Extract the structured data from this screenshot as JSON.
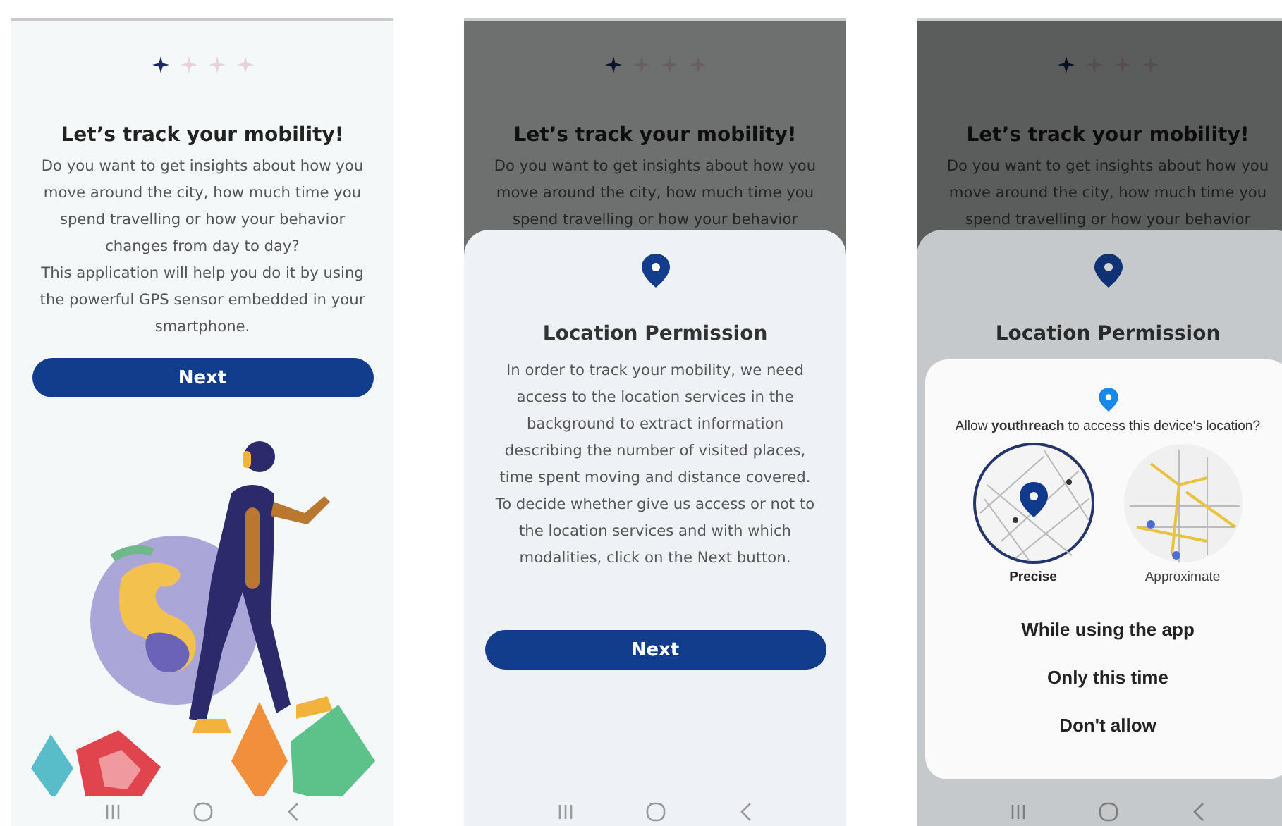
{
  "screens": [
    {
      "kind": "intro",
      "content": {
        "pager": [
          {
            "selected": true
          },
          {
            "selected": false
          },
          {
            "selected": false
          },
          {
            "selected": false
          }
        ],
        "title": "Let’s track your mobility!",
        "body": "Do you want to get insights about how you\nmove around the city, how much time you\nspend travelling or how your behavior\nchanges from day to day?\nThis application will help you do it by using\nthe powerful GPS sensor embedded in your\nsmartphone.",
        "button": "Next"
      }
    },
    {
      "kind": "permission_sheet",
      "content": {
        "pager": [
          {
            "selected": true
          },
          {
            "selected": false
          },
          {
            "selected": false
          },
          {
            "selected": false
          }
        ],
        "title": "Let’s track your mobility!",
        "body": "Do you want to get insights about how you\nmove around the city, how much time you\nspend travelling or how your behavior"
      },
      "sheet": {
        "title": "Location Permission",
        "body": "In order to track your mobility, we need\naccess to the location services in the\nbackground to extract information\ndescribing the number of visited places,\ntime spent moving and distance covered.\nTo decide whether give us access or not to\nthe location services and with which\nmodalities, click on the Next button.",
        "button": "Next"
      }
    },
    {
      "kind": "system_dialog",
      "content": {
        "pager": [
          {
            "selected": true
          },
          {
            "selected": false
          },
          {
            "selected": false
          },
          {
            "selected": false
          }
        ],
        "title": "Let’s track your mobility!",
        "body": "Do you want to get insights about how you\nmove around the city, how much time you\nspend travelling or how your behavior"
      },
      "sheet": {
        "title": "Location Permission"
      },
      "dialog": {
        "question": "Allow **youthreach** to access this device's location?",
        "options": [
          {
            "label": "Precise",
            "kind": "precise",
            "selected": true
          },
          {
            "label": "Approximate",
            "kind": "approximate",
            "selected": false
          }
        ],
        "actions": [
          "While using the app",
          "Only this time",
          "Don't allow"
        ]
      }
    }
  ]
}
